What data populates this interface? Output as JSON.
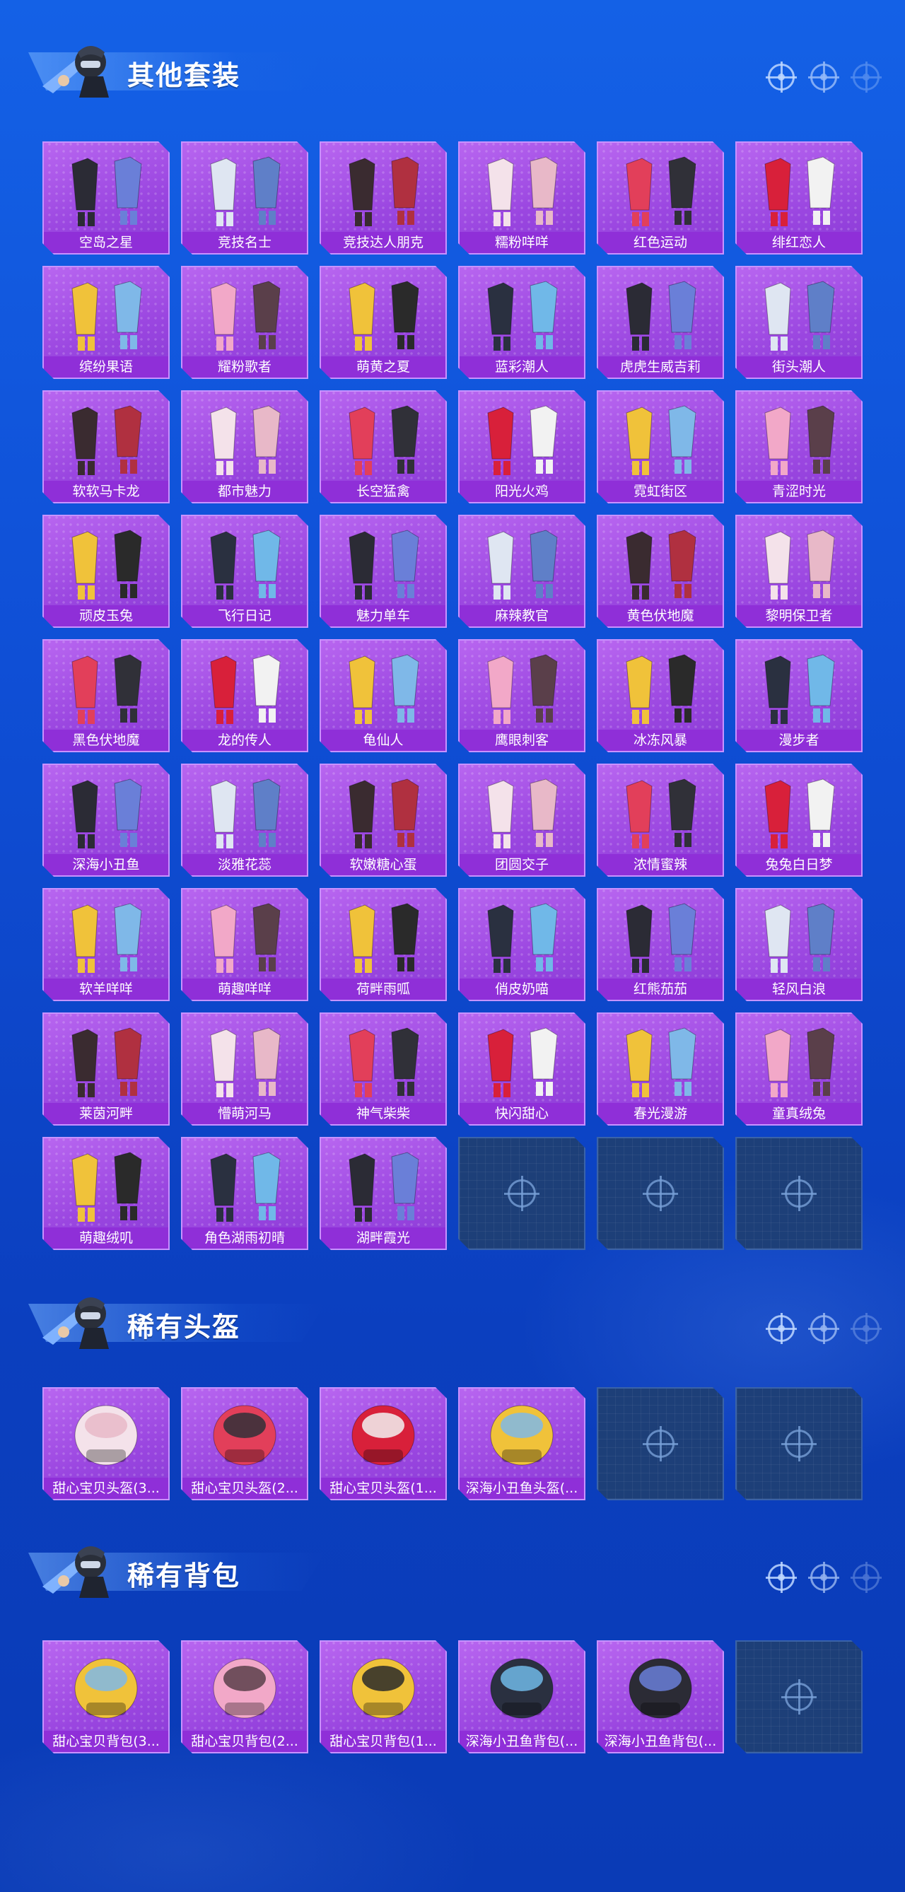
{
  "sections": [
    {
      "title": "其他套装",
      "items": [
        "空岛之星",
        "竞技名士",
        "竞技达人朋克",
        "糯粉咩咩",
        "红色运动",
        "绯红恋人",
        "缤纷果语",
        "耀粉歌者",
        "萌黄之夏",
        "蓝彩潮人",
        "虎虎生威吉莉",
        "街头潮人",
        "软软马卡龙",
        "都市魅力",
        "长空猛禽",
        "阳光火鸡",
        "霓虹街区",
        "青涩时光",
        "顽皮玉兔",
        "飞行日记",
        "魅力单车",
        "麻辣教官",
        "黄色伏地魔",
        "黎明保卫者",
        "黑色伏地魔",
        "龙的传人",
        "龟仙人",
        "鹰眼刺客",
        "冰冻风暴",
        "漫步者",
        "深海小丑鱼",
        "淡雅花蕊",
        "软嫩糖心蛋",
        "团圆交子",
        "浓情蜜辣",
        "兔兔白日梦",
        "软羊咩咩",
        "萌趣咩咩",
        "荷畔雨呱",
        "俏皮奶喵",
        "红熊茄茄",
        "轻风白浪",
        "莱茵河畔",
        "懵萌河马",
        "神气柴柴",
        "快闪甜心",
        "春光漫游",
        "童真绒兔",
        "萌趣绒叽",
        "角色湖雨初晴",
        "湖畔霞光"
      ]
    },
    {
      "title": "稀有头盔",
      "items": [
        "甜心宝贝头盔(3...",
        "甜心宝贝头盔(2...",
        "甜心宝贝头盔(1...",
        "深海小丑鱼头盔(..."
      ]
    },
    {
      "title": "稀有背包",
      "items": [
        "甜心宝贝背包(3...",
        "甜心宝贝背包(2...",
        "甜心宝贝背包(1...",
        "深海小丑鱼背包(...",
        "深海小丑鱼背包(..."
      ]
    }
  ],
  "empty_slot_icon": "crosshair-icon",
  "header_icon": "soldier-mascot-icon",
  "colors": {
    "background": "#0f4fd6",
    "card": "#9a46e0",
    "label_bar": "#8f2fd8",
    "empty_card": "#1d3f78"
  }
}
